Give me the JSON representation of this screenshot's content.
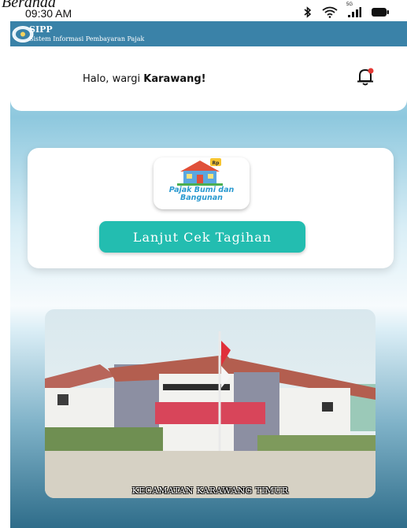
{
  "caption": "Beranda",
  "status_bar": {
    "time": "09:30 AM",
    "network_label": "5G"
  },
  "app_bar": {
    "name": "SIPP",
    "subtitle": "Sistem Informasi Pembayaran Pajak"
  },
  "greeting": {
    "prefix": "Halo, wargi ",
    "name": "Karawang!"
  },
  "service": {
    "label_line1": "Pajak Bumi dan",
    "label_line2": "Bangunan",
    "badge": "Rp"
  },
  "cta": {
    "label": "Lanjut Cek Tagihan"
  },
  "photo": {
    "caption": "KECAMATAN KARAWANG TIMUR"
  },
  "icons": {
    "bluetooth": "bluetooth-icon",
    "wifi": "wifi-icon",
    "signal": "signal-icon",
    "battery": "battery-icon",
    "bell": "bell-icon",
    "logo": "sipp-logo",
    "house": "house-icon"
  },
  "colors": {
    "app_bar": "#3a82a8",
    "button": "#23bdb0",
    "bell_dot": "#e53935",
    "pbb_text": "#2a9ad0"
  }
}
